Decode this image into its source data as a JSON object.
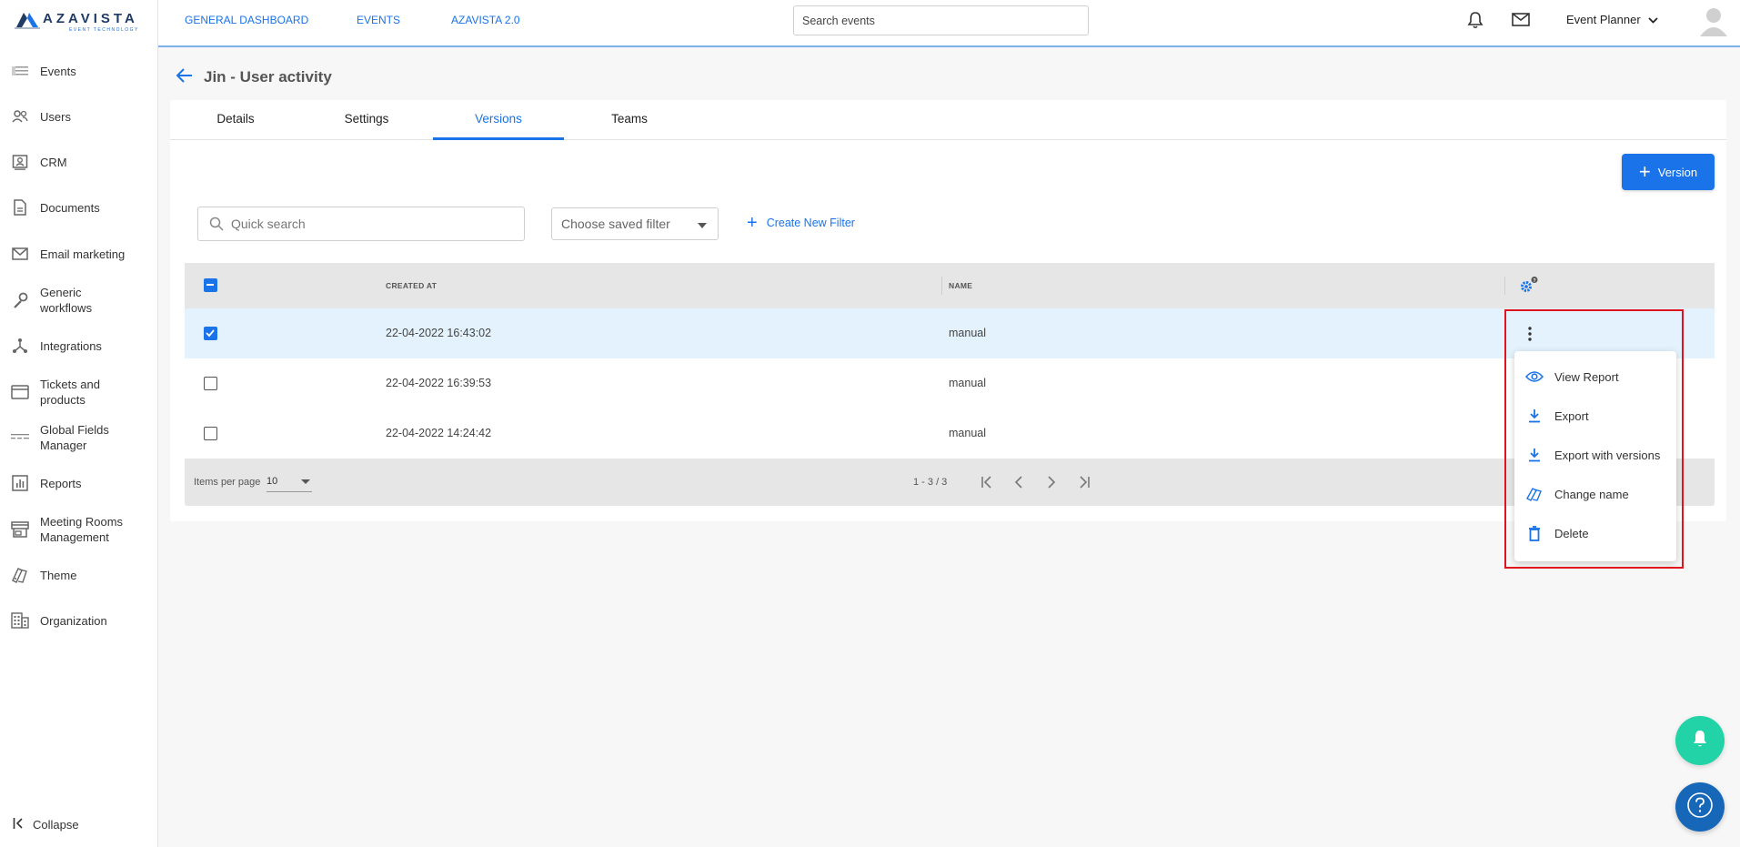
{
  "brand": {
    "name": "AZAVISTA",
    "tagline": "EVENT TECHNOLOGY"
  },
  "sidebar": {
    "items": [
      {
        "label": "Events",
        "icon": "events-icon"
      },
      {
        "label": "Users",
        "icon": "users-icon"
      },
      {
        "label": "CRM",
        "icon": "crm-icon"
      },
      {
        "label": "Documents",
        "icon": "document-icon"
      },
      {
        "label": "Email marketing",
        "icon": "mail-icon"
      },
      {
        "label": "Generic workflows",
        "icon": "wrench-icon"
      },
      {
        "label": "Integrations",
        "icon": "integrations-icon"
      },
      {
        "label": "Tickets and products",
        "icon": "ticket-icon"
      },
      {
        "label": "Global Fields Manager",
        "icon": "fields-icon"
      },
      {
        "label": "Reports",
        "icon": "reports-icon"
      },
      {
        "label": "Meeting Rooms Management",
        "icon": "store-icon"
      },
      {
        "label": "Theme",
        "icon": "theme-icon"
      },
      {
        "label": "Organization",
        "icon": "organization-icon"
      }
    ],
    "collapse_label": "Collapse"
  },
  "topbar": {
    "links": [
      "GENERAL DASHBOARD",
      "EVENTS",
      "AZAVISTA 2.0"
    ],
    "search_placeholder": "Search events",
    "user_role": "Event Planner"
  },
  "page": {
    "title": "Jin - User activity",
    "tabs": [
      "Details",
      "Settings",
      "Versions",
      "Teams"
    ],
    "active_tab": "Versions",
    "add_version_label": "Version",
    "quick_search_placeholder": "Quick search",
    "saved_filter_placeholder": "Choose saved filter",
    "create_filter_label": "Create New Filter"
  },
  "table": {
    "columns": [
      "CREATED AT",
      "NAME"
    ],
    "rows": [
      {
        "created_at": "22-04-2022 16:43:02",
        "name": "manual",
        "selected": true
      },
      {
        "created_at": "22-04-2022 16:39:53",
        "name": "manual",
        "selected": false
      },
      {
        "created_at": "22-04-2022 14:24:42",
        "name": "manual",
        "selected": false
      }
    ],
    "items_per_page_label": "Items per page",
    "items_per_page": "10",
    "range": "1 - 3 / 3"
  },
  "context_menu": {
    "items": [
      {
        "label": "View Report",
        "icon": "eye-icon"
      },
      {
        "label": "Export",
        "icon": "download-icon"
      },
      {
        "label": "Export with versions",
        "icon": "download-icon"
      },
      {
        "label": "Change name",
        "icon": "rename-icon"
      },
      {
        "label": "Delete",
        "icon": "trash-icon"
      }
    ]
  },
  "colors": {
    "accent": "#1a73e8",
    "selected_row": "#e3f2fc",
    "highlight": "#e0141e",
    "fab_bell": "#21d3a6",
    "fab_help": "#1767b8"
  }
}
